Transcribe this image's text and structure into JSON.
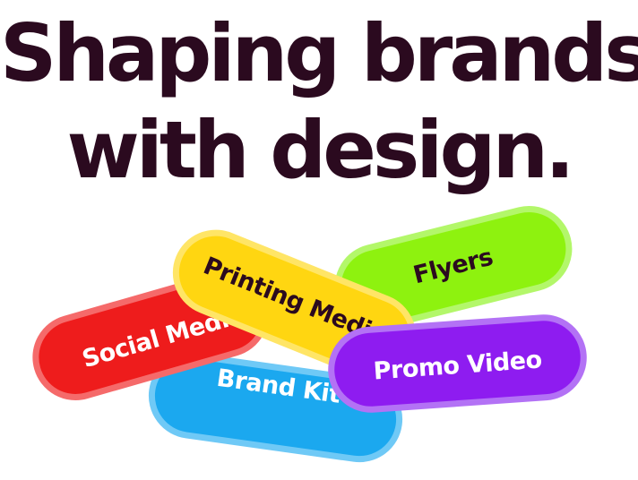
{
  "headline": {
    "line1": "Shaping brands",
    "line2": "with design."
  },
  "pills": {
    "flyers": "Flyers",
    "brand_kit": "Brand Kit",
    "social_media": "Social Media",
    "printing_media": "Printing Media",
    "promo_video": "Promo Video"
  },
  "colors": {
    "text_dark": "#2b0a1f",
    "flyers": "#8ef20f",
    "brand_kit": "#1ba8ef",
    "social_media": "#ee1c1c",
    "printing_media": "#ffd611",
    "promo_video": "#8e1cf0"
  }
}
